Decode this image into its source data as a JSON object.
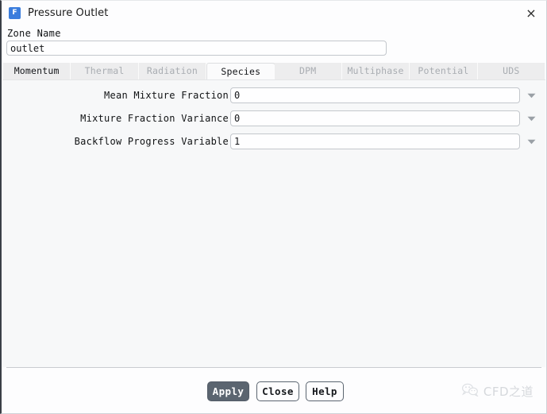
{
  "window": {
    "title": "Pressure Outlet",
    "app_icon": "fluent-icon",
    "app_icon_letter": "F",
    "close_icon": "×",
    "accent_color": "#3b7ddd",
    "panel_color": "#f7f8f9",
    "apply_button_color": "#5b6570"
  },
  "zone": {
    "label": "Zone Name",
    "value": "outlet",
    "placeholder": ""
  },
  "tabs": [
    {
      "label": "Momentum",
      "state": "enabled"
    },
    {
      "label": "Thermal",
      "state": "disabled"
    },
    {
      "label": "Radiation",
      "state": "disabled"
    },
    {
      "label": "Species",
      "state": "active"
    },
    {
      "label": "DPM",
      "state": "disabled"
    },
    {
      "label": "Multiphase",
      "state": "disabled"
    },
    {
      "label": "Potential",
      "state": "disabled"
    },
    {
      "label": "UDS",
      "state": "disabled"
    }
  ],
  "fields": [
    {
      "label": "Mean Mixture Fraction",
      "value": "0",
      "dropdown_icon": "chevron-down-icon"
    },
    {
      "label": "Mixture Fraction Variance",
      "value": "0",
      "dropdown_icon": "chevron-down-icon"
    },
    {
      "label": "Backflow Progress Variable",
      "value": "1",
      "dropdown_icon": "chevron-down-icon"
    }
  ],
  "footer": {
    "apply_label": "Apply",
    "close_label": "Close",
    "help_label": "Help",
    "watermark_text": "CFD之道",
    "watermark_icon": "wechat-logo-icon"
  }
}
